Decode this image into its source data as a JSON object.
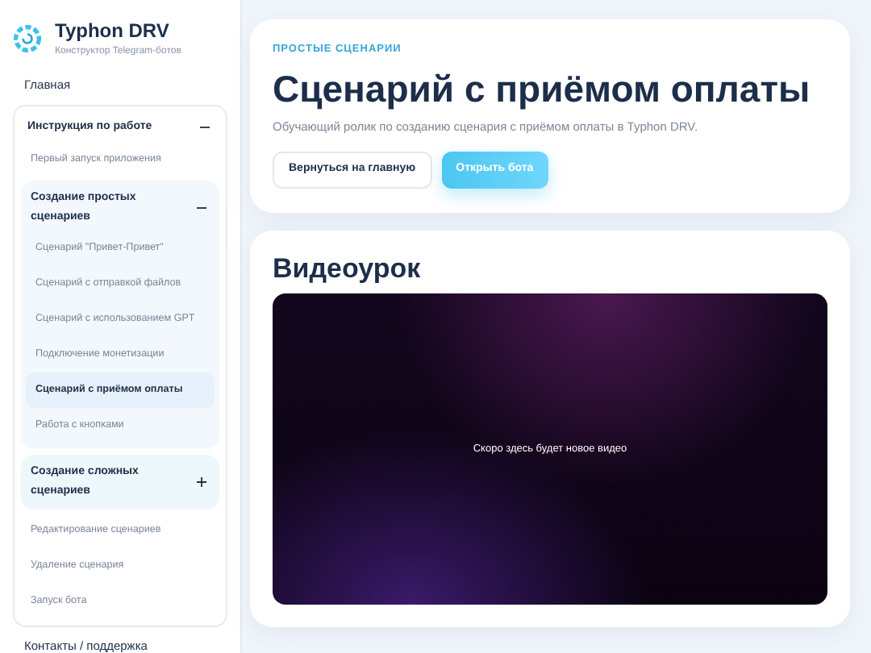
{
  "brand": {
    "title": "Typhon DRV",
    "subtitle": "Конструктор Telegram-ботов"
  },
  "sidebar": {
    "items": [
      {
        "kind": "link",
        "label": "Главная",
        "selected": false
      },
      {
        "kind": "group",
        "label": "Инструкция по работе",
        "expanded": true,
        "children": [
          {
            "kind": "link",
            "label": "Первый запуск приложения",
            "selected": false
          },
          {
            "kind": "group",
            "label": "Создание простых сценариев",
            "expanded": true,
            "children": [
              {
                "kind": "link",
                "label": "Сценарий \"Привет-Привет\"",
                "selected": false
              },
              {
                "kind": "link",
                "label": "Сценарий с отправкой файлов",
                "selected": false
              },
              {
                "kind": "link",
                "label": "Сценарий с использованием GPT",
                "selected": false
              },
              {
                "kind": "link",
                "label": "Подключение монетизации",
                "selected": false
              },
              {
                "kind": "link",
                "label": "Сценарий с приёмом оплаты",
                "selected": true
              },
              {
                "kind": "link",
                "label": "Работа с кнопками",
                "selected": false
              }
            ]
          },
          {
            "kind": "group",
            "label": "Создание сложных сценариев",
            "expanded": false
          },
          {
            "kind": "link",
            "label": "Редактирование сценариев",
            "selected": false
          },
          {
            "kind": "link",
            "label": "Удаление сценария",
            "selected": false
          },
          {
            "kind": "link",
            "label": "Запуск бота",
            "selected": false
          }
        ]
      },
      {
        "kind": "link",
        "label": "Контакты / поддержка",
        "selected": false
      }
    ]
  },
  "header": {
    "eyebrow": "ПРОСТЫЕ СЦЕНАРИИ",
    "title": "Сценарий с приёмом оплаты",
    "description": "Обучающий ролик по созданию сценария с приёмом оплаты в Typhon DRV.",
    "buttons": [
      {
        "label": "Вернуться на главную",
        "kind": "secondary"
      },
      {
        "label": "Открыть бота",
        "kind": "primary"
      }
    ]
  },
  "video": {
    "title": "Видеоурок",
    "message": "Скоро здесь будет новое видео"
  }
}
